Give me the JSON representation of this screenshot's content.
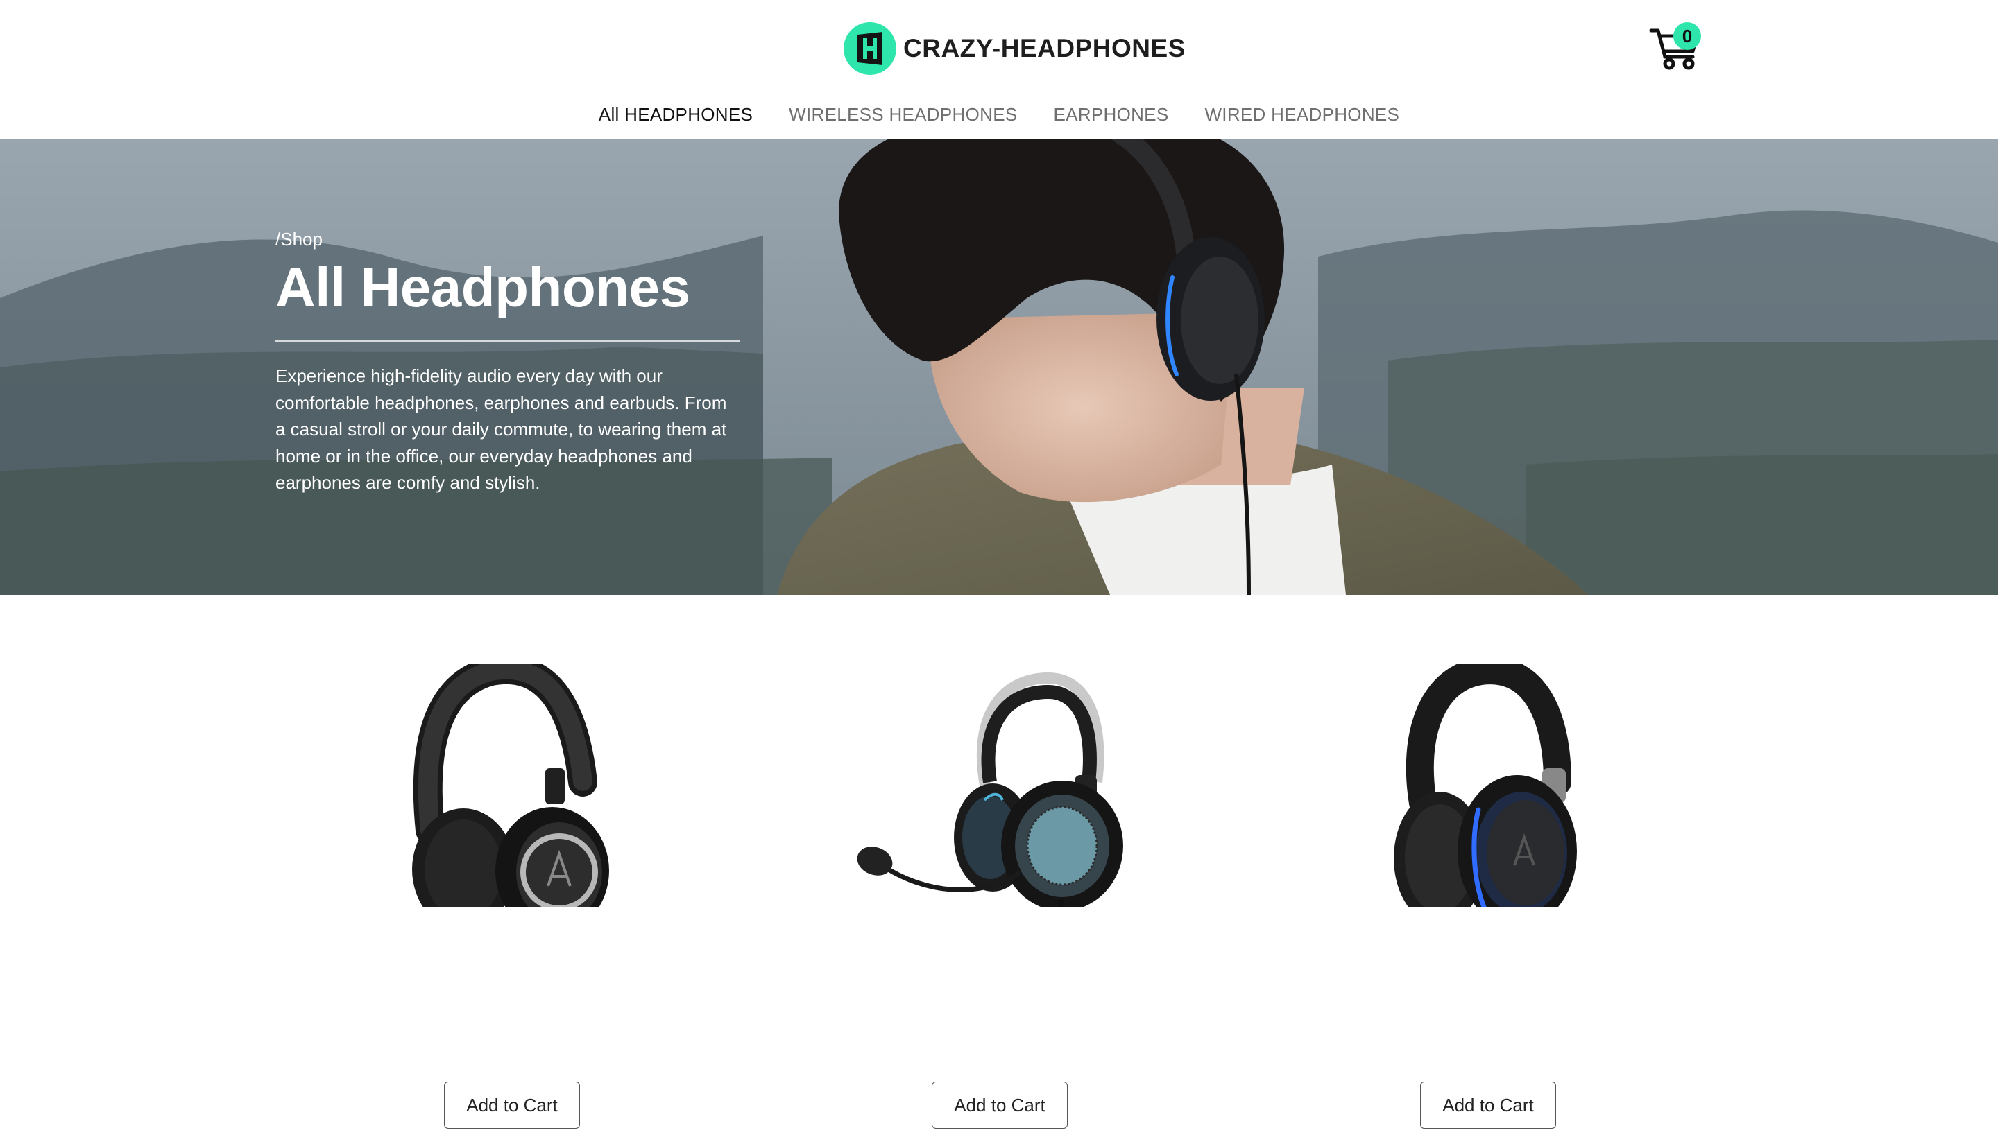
{
  "brand": {
    "name": "CRAZY-HEADPHONES",
    "accent": "#2ee6ac"
  },
  "cart": {
    "count": "0"
  },
  "nav": [
    {
      "label": "All HEADPHONES",
      "active": true
    },
    {
      "label": "WIRELESS HEADPHONES",
      "active": false
    },
    {
      "label": "EARPHONES",
      "active": false
    },
    {
      "label": "WIRED HEADPHONES",
      "active": false
    }
  ],
  "hero": {
    "breadcrumb": "/Shop",
    "title": "All Headphones",
    "description": "Experience high-fidelity audio every day with our comfortable headphones, earphones and earbuds. From a casual stroll or your daily commute, to wearing them at home or in the office, our everyday headphones and earphones are comfy and stylish."
  },
  "products": [
    {
      "button_label": "Add to Cart",
      "icon": "over-ear-headphones-icon"
    },
    {
      "button_label": "Add to Cart",
      "icon": "gaming-headset-icon"
    },
    {
      "button_label": "Add to Cart",
      "icon": "blue-accent-headphones-icon"
    }
  ]
}
